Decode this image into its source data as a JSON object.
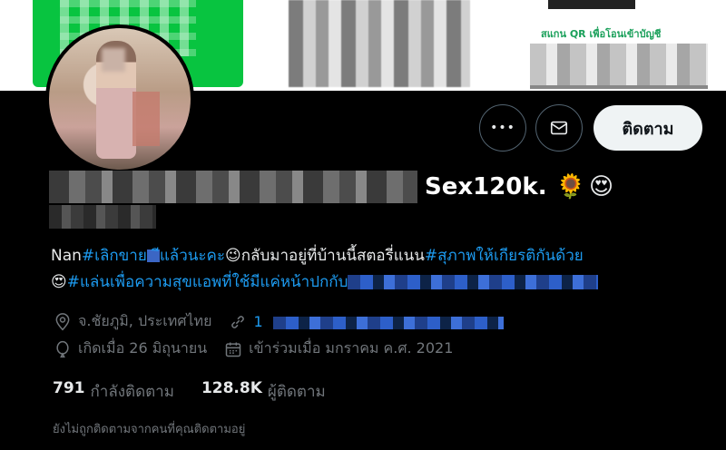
{
  "banner": {
    "caption": "สแกน QR เพื่อโอนเข้าบัญชี"
  },
  "actions": {
    "more_label": "•••",
    "follow_label": "ติดตาม"
  },
  "profile": {
    "name_visible": "Sex120k.",
    "name_emojis": [
      "🌻",
      "😍"
    ],
    "bio": {
      "prefix": "Nan",
      "hashtag1": "#เลิกขาย",
      "hashtag1_tail": "ีแล้วนะคะ",
      "emoji1": "😉",
      "text1": "กลับมาอยู่ที่บ้านนี้สตอรี่แนน",
      "hashtag2": "#สุภาพให้เกียรติกันด้วย",
      "emoji2": "😍",
      "hashtag3": "#แล่นเพื่อความสุขแอพที่ใช้มีแค่หน้าปกกับ"
    },
    "location": "จ.ชัยภูมิ, ประเทศไทย",
    "link_prefix": "1",
    "born": "เกิดเมื่อ 26 มิถุนายน",
    "joined": "เข้าร่วมเมื่อ มกราคม ค.ศ. 2021"
  },
  "stats": {
    "following_count": "791",
    "following_label": "กำลังติดตาม",
    "followers_count": "128.8K",
    "followers_label": "ผู้ติดตาม"
  },
  "footer": {
    "not_followed_text": "ยังไม่ถูกติดตามจากคนที่คุณติดตามอยู่"
  },
  "icons": {
    "more": "more-horizontal-icon",
    "message": "envelope-icon",
    "location": "map-pin-icon",
    "link": "link-icon",
    "birthday": "balloon-icon",
    "calendar": "calendar-icon"
  }
}
